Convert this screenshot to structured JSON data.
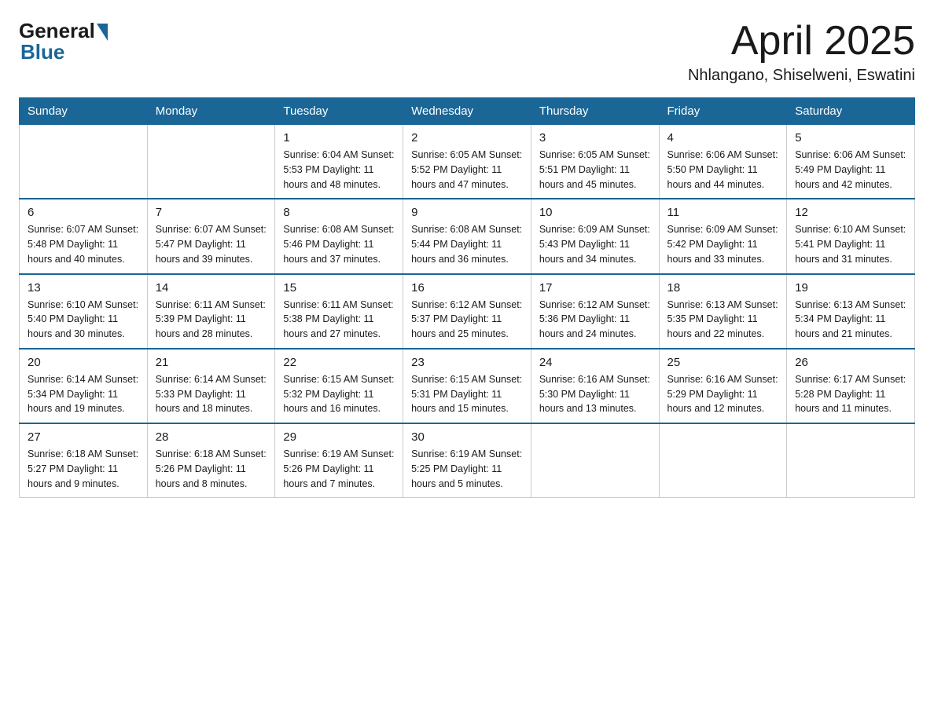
{
  "logo": {
    "general": "General",
    "blue": "Blue"
  },
  "header": {
    "month": "April 2025",
    "location": "Nhlangano, Shiselweni, Eswatini"
  },
  "weekdays": [
    "Sunday",
    "Monday",
    "Tuesday",
    "Wednesday",
    "Thursday",
    "Friday",
    "Saturday"
  ],
  "weeks": [
    [
      {
        "day": "",
        "info": ""
      },
      {
        "day": "",
        "info": ""
      },
      {
        "day": "1",
        "info": "Sunrise: 6:04 AM\nSunset: 5:53 PM\nDaylight: 11 hours\nand 48 minutes."
      },
      {
        "day": "2",
        "info": "Sunrise: 6:05 AM\nSunset: 5:52 PM\nDaylight: 11 hours\nand 47 minutes."
      },
      {
        "day": "3",
        "info": "Sunrise: 6:05 AM\nSunset: 5:51 PM\nDaylight: 11 hours\nand 45 minutes."
      },
      {
        "day": "4",
        "info": "Sunrise: 6:06 AM\nSunset: 5:50 PM\nDaylight: 11 hours\nand 44 minutes."
      },
      {
        "day": "5",
        "info": "Sunrise: 6:06 AM\nSunset: 5:49 PM\nDaylight: 11 hours\nand 42 minutes."
      }
    ],
    [
      {
        "day": "6",
        "info": "Sunrise: 6:07 AM\nSunset: 5:48 PM\nDaylight: 11 hours\nand 40 minutes."
      },
      {
        "day": "7",
        "info": "Sunrise: 6:07 AM\nSunset: 5:47 PM\nDaylight: 11 hours\nand 39 minutes."
      },
      {
        "day": "8",
        "info": "Sunrise: 6:08 AM\nSunset: 5:46 PM\nDaylight: 11 hours\nand 37 minutes."
      },
      {
        "day": "9",
        "info": "Sunrise: 6:08 AM\nSunset: 5:44 PM\nDaylight: 11 hours\nand 36 minutes."
      },
      {
        "day": "10",
        "info": "Sunrise: 6:09 AM\nSunset: 5:43 PM\nDaylight: 11 hours\nand 34 minutes."
      },
      {
        "day": "11",
        "info": "Sunrise: 6:09 AM\nSunset: 5:42 PM\nDaylight: 11 hours\nand 33 minutes."
      },
      {
        "day": "12",
        "info": "Sunrise: 6:10 AM\nSunset: 5:41 PM\nDaylight: 11 hours\nand 31 minutes."
      }
    ],
    [
      {
        "day": "13",
        "info": "Sunrise: 6:10 AM\nSunset: 5:40 PM\nDaylight: 11 hours\nand 30 minutes."
      },
      {
        "day": "14",
        "info": "Sunrise: 6:11 AM\nSunset: 5:39 PM\nDaylight: 11 hours\nand 28 minutes."
      },
      {
        "day": "15",
        "info": "Sunrise: 6:11 AM\nSunset: 5:38 PM\nDaylight: 11 hours\nand 27 minutes."
      },
      {
        "day": "16",
        "info": "Sunrise: 6:12 AM\nSunset: 5:37 PM\nDaylight: 11 hours\nand 25 minutes."
      },
      {
        "day": "17",
        "info": "Sunrise: 6:12 AM\nSunset: 5:36 PM\nDaylight: 11 hours\nand 24 minutes."
      },
      {
        "day": "18",
        "info": "Sunrise: 6:13 AM\nSunset: 5:35 PM\nDaylight: 11 hours\nand 22 minutes."
      },
      {
        "day": "19",
        "info": "Sunrise: 6:13 AM\nSunset: 5:34 PM\nDaylight: 11 hours\nand 21 minutes."
      }
    ],
    [
      {
        "day": "20",
        "info": "Sunrise: 6:14 AM\nSunset: 5:34 PM\nDaylight: 11 hours\nand 19 minutes."
      },
      {
        "day": "21",
        "info": "Sunrise: 6:14 AM\nSunset: 5:33 PM\nDaylight: 11 hours\nand 18 minutes."
      },
      {
        "day": "22",
        "info": "Sunrise: 6:15 AM\nSunset: 5:32 PM\nDaylight: 11 hours\nand 16 minutes."
      },
      {
        "day": "23",
        "info": "Sunrise: 6:15 AM\nSunset: 5:31 PM\nDaylight: 11 hours\nand 15 minutes."
      },
      {
        "day": "24",
        "info": "Sunrise: 6:16 AM\nSunset: 5:30 PM\nDaylight: 11 hours\nand 13 minutes."
      },
      {
        "day": "25",
        "info": "Sunrise: 6:16 AM\nSunset: 5:29 PM\nDaylight: 11 hours\nand 12 minutes."
      },
      {
        "day": "26",
        "info": "Sunrise: 6:17 AM\nSunset: 5:28 PM\nDaylight: 11 hours\nand 11 minutes."
      }
    ],
    [
      {
        "day": "27",
        "info": "Sunrise: 6:18 AM\nSunset: 5:27 PM\nDaylight: 11 hours\nand 9 minutes."
      },
      {
        "day": "28",
        "info": "Sunrise: 6:18 AM\nSunset: 5:26 PM\nDaylight: 11 hours\nand 8 minutes."
      },
      {
        "day": "29",
        "info": "Sunrise: 6:19 AM\nSunset: 5:26 PM\nDaylight: 11 hours\nand 7 minutes."
      },
      {
        "day": "30",
        "info": "Sunrise: 6:19 AM\nSunset: 5:25 PM\nDaylight: 11 hours\nand 5 minutes."
      },
      {
        "day": "",
        "info": ""
      },
      {
        "day": "",
        "info": ""
      },
      {
        "day": "",
        "info": ""
      }
    ]
  ]
}
